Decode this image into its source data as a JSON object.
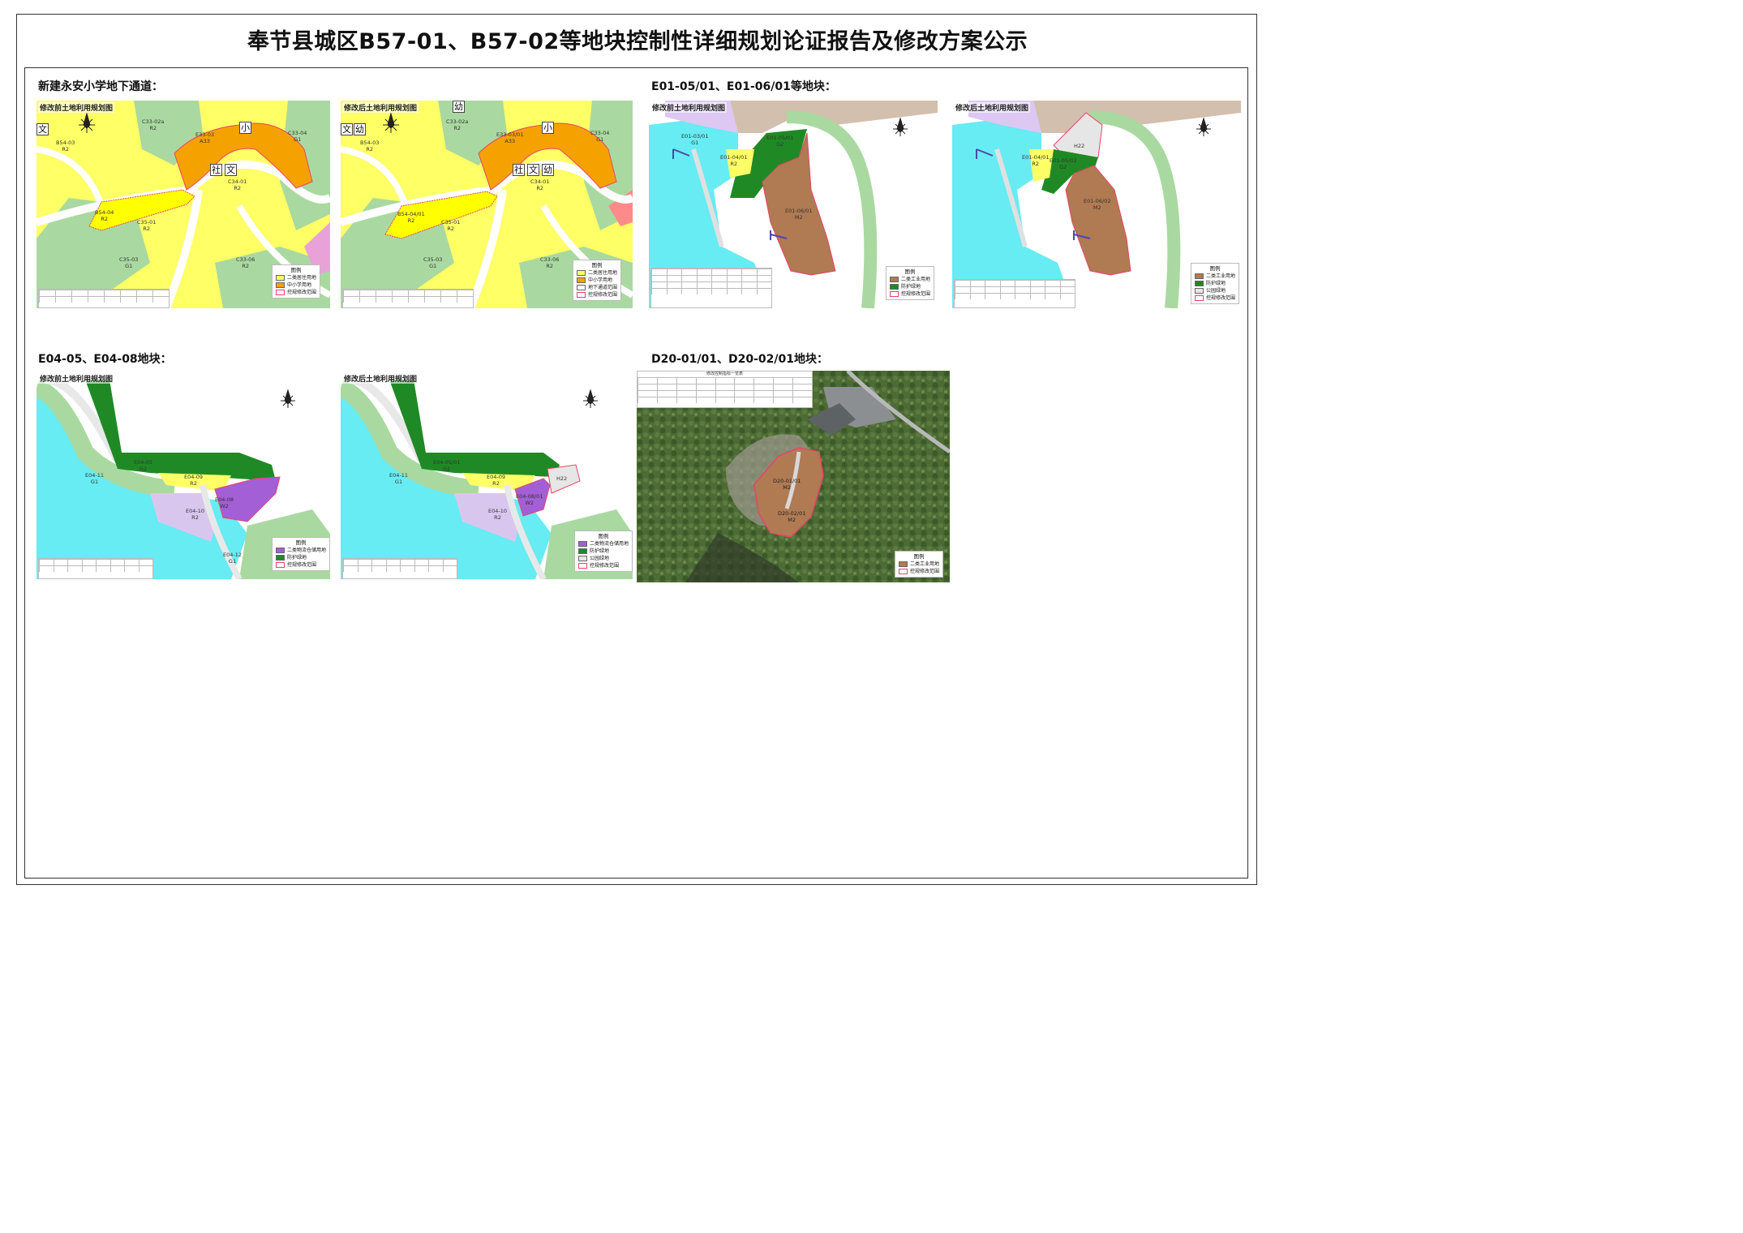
{
  "title": "奉节县城区B57-01、B57-02等地块控制性详细规划论证报告及修改方案公示",
  "sections": {
    "s1": "新建永安小学地下通道：",
    "s2": "E01-05/01、E01-06/01等地块：",
    "s3": "E04-05、E04-08地块：",
    "s4": "D20-01/01、D20-02/01地块："
  },
  "maps": {
    "before_label": "修改前土地利用规划图",
    "after_label": "修改后土地利用规划图",
    "table_caption_d20": "修改控制指标一览表",
    "m1": {
      "title": "修改前土地利用规划图",
      "legend_title": "图例",
      "legend": [
        "二类居住用地",
        "中小学用地",
        "控规修改范围"
      ],
      "parcels": [
        "E33-03\nA33",
        "B54-04\nR2",
        "C34-01\nR2",
        "C35-01\nR2",
        "C35-03\nG1",
        "C33-06\nR2",
        "C33-02a\nR2",
        "B54-03\nR2",
        "C33-04\nG1"
      ],
      "chars": [
        "文",
        "小",
        "社",
        "文"
      ]
    },
    "m2": {
      "title": "修改后土地利用规划图",
      "legend_title": "图例",
      "legend": [
        "二类居住用地",
        "中小学用地",
        "地下通道范围",
        "控规修改范围"
      ],
      "parcels": [
        "E33-03/01\nA33",
        "B54-04/01\nR2",
        "C34-01\nR2",
        "C35-01\nR2",
        "C35-03\nG1",
        "C33-06\nR2",
        "C33-02a\nR2",
        "B54-03\nR2",
        "C33-04\nG1"
      ],
      "chars": [
        "文",
        "幼",
        "小",
        "社",
        "文",
        "幼",
        "幼"
      ]
    },
    "m3": {
      "title": "修改前土地利用规划图",
      "legend_title": "图例",
      "legend": [
        "二类工业用地",
        "防护绿地",
        "控规修改范围"
      ],
      "parcels": [
        "E01-05/01\nG2",
        "E01-06/01\nM2",
        "E01-04/01\nR2",
        "E01-03/01\nG1"
      ]
    },
    "m4": {
      "title": "修改后土地利用规划图",
      "legend_title": "图例",
      "legend": [
        "二类工业用地",
        "防护绿地",
        "公园绿地",
        "控规修改范围"
      ],
      "parcels": [
        "E01-05/02\nG2",
        "E01-06/02\nM2",
        "E01-04/01\nR2",
        "H22"
      ]
    },
    "m5": {
      "title": "修改前土地利用规划图",
      "legend_title": "图例",
      "legend": [
        "二类物流仓储用地",
        "防护绿地",
        "控规修改范围"
      ],
      "parcels": [
        "E04-05\nG2",
        "E04-08\nW2",
        "E04-09\nR2",
        "E04-10\nR2",
        "E04-11\nG1",
        "E04-12\nG1"
      ]
    },
    "m6": {
      "title": "修改后土地利用规划图",
      "legend_title": "图例",
      "legend": [
        "二类物流仓储用地",
        "防护绿地",
        "公园绿地",
        "控规修改范围"
      ],
      "parcels": [
        "E04-05/01\nG2",
        "E04-08/01\nW2",
        "E04-09\nR2",
        "E04-10\nR2",
        "E04-11\nG1",
        "H22"
      ]
    },
    "m7": {
      "legend_title": "图例",
      "legend": [
        "二类工业用地",
        "控规修改范围"
      ],
      "parcels": [
        "D20-01/01\nM2",
        "D20-02/01\nM2"
      ]
    }
  },
  "colors": {
    "residential": "#ffff66",
    "school": "#f5a100",
    "green": "#a9d9a0",
    "protect_green": "#1f8a25",
    "park_green": "#8fcf8a",
    "industrial": "#b07a52",
    "logistics": "#a35fd6",
    "logistics_light": "#d9c6ee",
    "water": "#66ecf2",
    "road": "#ffffff",
    "boundary": "#e8446a",
    "base_tan": "#d2bfae"
  }
}
